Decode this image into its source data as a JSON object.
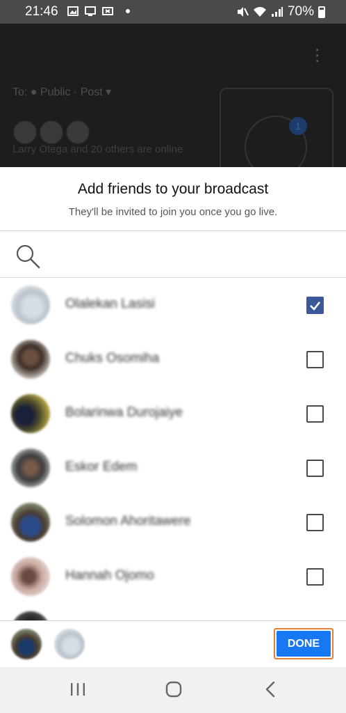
{
  "status_bar": {
    "time": "21:46",
    "battery": "70%",
    "icons": [
      "image-icon",
      "cast-icon",
      "video-icon",
      "dot-icon",
      "mute-icon",
      "wifi-icon",
      "signal-icon",
      "battery-icon"
    ]
  },
  "live_background": {
    "audience_text": "To: ● Public · Post ▾",
    "online_text": "Larry Otega and 20 others are online",
    "invite_badge_count": "1"
  },
  "sheet": {
    "title": "Add friends to your broadcast",
    "subtitle": "They'll be invited to join you once you go live.",
    "search_icon": "search-icon"
  },
  "friends": [
    {
      "name": "Olalekan Lasisi",
      "checked": true
    },
    {
      "name": "Chuks Osomiha",
      "checked": false
    },
    {
      "name": "Bolarinwa Durojaiye",
      "checked": false
    },
    {
      "name": "Eskor Edem",
      "checked": false
    },
    {
      "name": "Solomon Ahoritawere",
      "checked": false
    },
    {
      "name": "Hannah Ojomo",
      "checked": false
    }
  ],
  "footer": {
    "done_label": "DONE"
  },
  "colors": {
    "accent": "#1877f2",
    "checkbox_checked": "#3b5998",
    "done_outline": "#e0803a"
  }
}
